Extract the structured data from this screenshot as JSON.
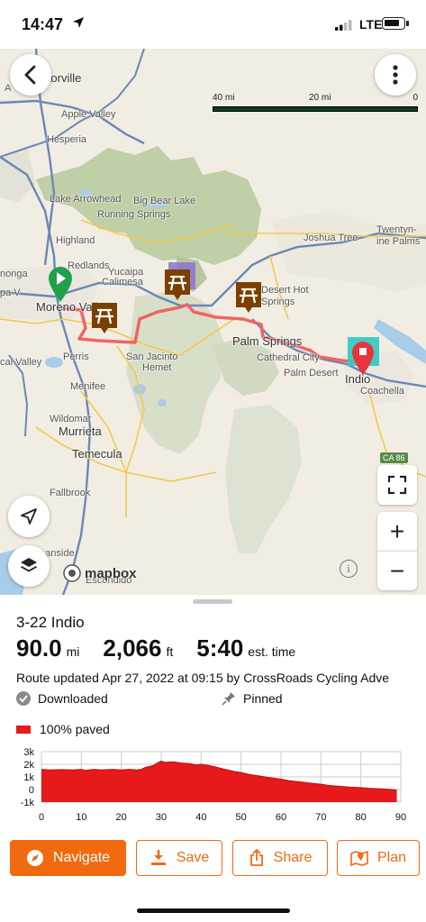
{
  "status_bar": {
    "time": "14:47",
    "network": "LTE"
  },
  "map": {
    "scale": {
      "labels": [
        "40 mi",
        "20 mi",
        "0"
      ]
    },
    "attribution": "mapbox",
    "info_glyph": "i",
    "labels": {
      "victorville": "Victorville",
      "apple_valley": "Apple Valley",
      "hesperia": "Hesperia",
      "lake_arrowhead": "Lake Arrowhead",
      "big_bear_lake": "Big Bear Lake",
      "running_springs": "Running Springs",
      "highland": "Highland",
      "redlands": "Redlands",
      "yucaipa": "Yucaipa",
      "calimesa": "Calimesa",
      "joshua_tree": "Joshua Tree",
      "twentynine_palms": "Twentyn­ine Palms",
      "desert_hot_springs": "Desert Hot Springs",
      "palm_springs": "Palm Springs",
      "cathedral_city": "Cathedral City",
      "palm_desert": "Palm Desert",
      "indio": "Indio",
      "coachella": "Coachella",
      "moreno_valley": "Moreno Valley",
      "perris": "Perris",
      "san_jacinto": "San Jacinto",
      "hemet": "Hemet",
      "menifee": "Menifee",
      "wildomar": "Wildomar",
      "murrieta": "Murrieta",
      "temecula": "Temecula",
      "fallbrook": "Fallbrook",
      "oceanside": "Oceanside",
      "escondido": "Escondido",
      "ca86": "CA 86",
      "ontario_frag": "nonga",
      "a_frag": "A",
      "cal_valley": "cal Valley",
      "pa_frag": "pa V"
    },
    "icons": {
      "back": "chevron-left-icon",
      "more": "more-vertical-icon",
      "locate": "location-arrow-icon",
      "layers": "layers-icon",
      "fullscreen": "fullscreen-icon",
      "zoom_in": "+",
      "zoom_out": "−"
    },
    "colors": {
      "route": "#f06464",
      "start": "#1fa04a",
      "end": "#e8343c",
      "poi": "#7b3f00"
    }
  },
  "route": {
    "name": "3-22 Indio",
    "distance_value": "90.0",
    "distance_unit": "mi",
    "elevation_value": "2,066",
    "elevation_unit": "ft",
    "time_value": "5:40",
    "time_unit": "est. time",
    "updated": "Route updated Apr 27, 2022 at 09:15 by CrossRoads Cycling Adve",
    "downloaded": "Downloaded",
    "pinned": "Pinned",
    "surface": "100% paved",
    "surface_color": "#e8191a"
  },
  "chart_data": {
    "type": "area",
    "title": "",
    "xlabel": "",
    "ylabel": "",
    "x_ticks": [
      "0",
      "10",
      "20",
      "30",
      "40",
      "50",
      "60",
      "70",
      "80",
      "90"
    ],
    "y_ticks": [
      "3k",
      "2k",
      "1k",
      "0",
      "-1k"
    ],
    "xlim": [
      0,
      90
    ],
    "ylim": [
      -1000,
      3000
    ],
    "grid": true,
    "series": [
      {
        "x": [
          0,
          2,
          5,
          8,
          10,
          11,
          13,
          15,
          18,
          20,
          22,
          24,
          25,
          26,
          28,
          29,
          30,
          31,
          33,
          35,
          37,
          39,
          40,
          42,
          44,
          46,
          48,
          50,
          52,
          55,
          57,
          60,
          62,
          65,
          67,
          70,
          72,
          75,
          77,
          80,
          82,
          85,
          87,
          88,
          89
        ],
        "y": [
          1600,
          1550,
          1580,
          1550,
          1600,
          1520,
          1600,
          1550,
          1600,
          1550,
          1600,
          1550,
          1600,
          1750,
          1900,
          2100,
          2250,
          2150,
          2200,
          2100,
          2050,
          1950,
          2000,
          1900,
          1750,
          1600,
          1450,
          1350,
          1200,
          1050,
          950,
          820,
          700,
          600,
          520,
          420,
          320,
          250,
          200,
          150,
          100,
          50,
          20,
          0,
          -50
        ],
        "color": "#e8191a"
      }
    ]
  },
  "actions": {
    "navigate": "Navigate",
    "save": "Save",
    "share": "Share",
    "plan": "Plan"
  }
}
